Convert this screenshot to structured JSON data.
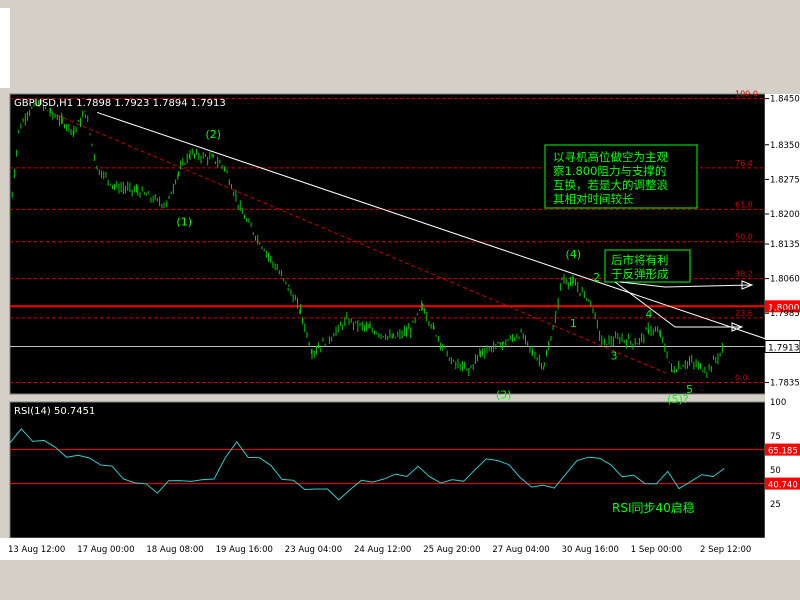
{
  "window": {
    "symbol_header": "GBPUSD,H1  1.7898 1.7923 1.7894 1.7913"
  },
  "chart_data": [
    {
      "type": "ohlc",
      "symbol": "GBPUSD",
      "timeframe": "H1",
      "last_ohlc": {
        "open": 1.7898,
        "high": 1.7923,
        "low": 1.7894,
        "close": 1.7913
      },
      "current_price": "1.7913",
      "ylim": [
        1.781,
        1.846
      ],
      "price_ticks": [
        "1.8450",
        "1.8350",
        "1.8275",
        "1.8200",
        "1.8135",
        "1.8060",
        "1.7985",
        "1.7835"
      ],
      "x_ticks": [
        "13 Aug 12:00",
        "17 Aug 00:00",
        "18 Aug 08:00",
        "19 Aug 16:00",
        "23 Aug 04:00",
        "24 Aug 12:00",
        "25 Aug 20:00",
        "27 Aug 04:00",
        "30 Aug 16:00",
        "1 Sep 00:00",
        "2 Sep 12:00"
      ],
      "price_path": [
        [
          0,
          1.82
        ],
        [
          0.015,
          1.838
        ],
        [
          0.03,
          1.842
        ],
        [
          0.05,
          1.844
        ],
        [
          0.07,
          1.842
        ],
        [
          0.09,
          1.84
        ],
        [
          0.11,
          1.838
        ],
        [
          0.13,
          1.842
        ],
        [
          0.15,
          1.83
        ],
        [
          0.18,
          1.826
        ],
        [
          0.22,
          1.825
        ],
        [
          0.25,
          1.823
        ],
        [
          0.27,
          1.822
        ],
        [
          0.29,
          1.829
        ],
        [
          0.31,
          1.833
        ],
        [
          0.35,
          1.832
        ],
        [
          0.37,
          1.83
        ],
        [
          0.4,
          1.82
        ],
        [
          0.43,
          1.814
        ],
        [
          0.46,
          1.808
        ],
        [
          0.48,
          1.804
        ],
        [
          0.5,
          1.799
        ],
        [
          0.52,
          1.79
        ],
        [
          0.55,
          1.793
        ],
        [
          0.58,
          1.797
        ],
        [
          0.62,
          1.795
        ],
        [
          0.66,
          1.793
        ],
        [
          0.69,
          1.795
        ],
        [
          0.71,
          1.8
        ],
        [
          0.73,
          1.795
        ],
        [
          0.76,
          1.788
        ],
        [
          0.79,
          1.786
        ],
        [
          0.81,
          1.79
        ],
        [
          0.85,
          1.792
        ],
        [
          0.88,
          1.794
        ],
        [
          0.9,
          1.79
        ],
        [
          0.92,
          1.787
        ],
        [
          0.94,
          1.798
        ],
        [
          0.95,
          1.806
        ],
        [
          0.97,
          1.805
        ],
        [
          1.0,
          1.801
        ],
        [
          1.02,
          1.792
        ],
        [
          1.05,
          1.793
        ],
        [
          1.08,
          1.792
        ],
        [
          1.1,
          1.795
        ],
        [
          1.12,
          1.794
        ],
        [
          1.14,
          1.786
        ],
        [
          1.17,
          1.788
        ],
        [
          1.2,
          1.786
        ],
        [
          1.23,
          1.791
        ]
      ],
      "fibonacci": [
        {
          "label": "100.0",
          "price": 1.845
        },
        {
          "label": "76.4",
          "price": 1.83
        },
        {
          "label": "61.8",
          "price": 1.821
        },
        {
          "label": "50.0",
          "price": 1.814
        },
        {
          "label": "38.2",
          "price": 1.806
        },
        {
          "label": "23.6",
          "price": 1.7975
        },
        {
          "label": "0.0",
          "price": 1.7835
        }
      ],
      "resistance": {
        "price": 1.8,
        "label": "1.8000"
      },
      "trendline_from": [
        0.15,
        1.842
      ],
      "trendline_to": [
        1.3,
        1.793
      ],
      "dashed_trend_from": [
        0.07,
        1.842
      ],
      "dashed_trend_to": [
        1.13,
        1.7855
      ],
      "wave_labels": [
        {
          "text": "(1)",
          "x": 0.3,
          "y": 1.8175
        },
        {
          "text": "(2)",
          "x": 0.35,
          "y": 1.8365
        },
        {
          "text": "(3)",
          "x": 0.85,
          "y": 1.78
        },
        {
          "text": "(4)",
          "x": 0.97,
          "y": 1.8105
        },
        {
          "text": "(5)?",
          "x": 1.15,
          "y": 1.779
        },
        {
          "text": "1",
          "x": 0.97,
          "y": 1.7955
        },
        {
          "text": "2",
          "x": 1.01,
          "y": 1.8055
        },
        {
          "text": "3",
          "x": 1.04,
          "y": 1.7885
        },
        {
          "text": "4",
          "x": 1.1,
          "y": 1.7975
        },
        {
          "text": "5",
          "x": 1.17,
          "y": 1.7812
        }
      ],
      "annotations": [
        {
          "id": "main-note",
          "lines": [
            "以寻机高位做空为主观",
            "察1.800阻力与支撑的",
            "互换，若是大的调整浪",
            "其相对时间较长"
          ]
        },
        {
          "id": "rebound-note",
          "lines": [
            "后市将有利",
            "于反弹形成"
          ]
        }
      ]
    },
    {
      "type": "line",
      "indicator": "RSI(14)",
      "value": "50.7451",
      "ylim": [
        0,
        100
      ],
      "ticks": [
        "100",
        "75",
        "50",
        "25"
      ],
      "levels": [
        {
          "value": 65,
          "label": "65.185"
        },
        {
          "value": 40,
          "label": "40.740"
        }
      ],
      "note": "RSI同步40启稳",
      "values": [
        70,
        78,
        74,
        70,
        66,
        62,
        58,
        60,
        55,
        50,
        46,
        40,
        38,
        36,
        40,
        42,
        44,
        40,
        45,
        60,
        68,
        62,
        58,
        52,
        46,
        40,
        36,
        38,
        33,
        30,
        36,
        40,
        44,
        42,
        46,
        48,
        50,
        46,
        42,
        40,
        44,
        50,
        56,
        60,
        52,
        44,
        40,
        36,
        38,
        48,
        54,
        62,
        58,
        52,
        48,
        44,
        40,
        42,
        46,
        38,
        42,
        44,
        48,
        50
      ]
    }
  ]
}
